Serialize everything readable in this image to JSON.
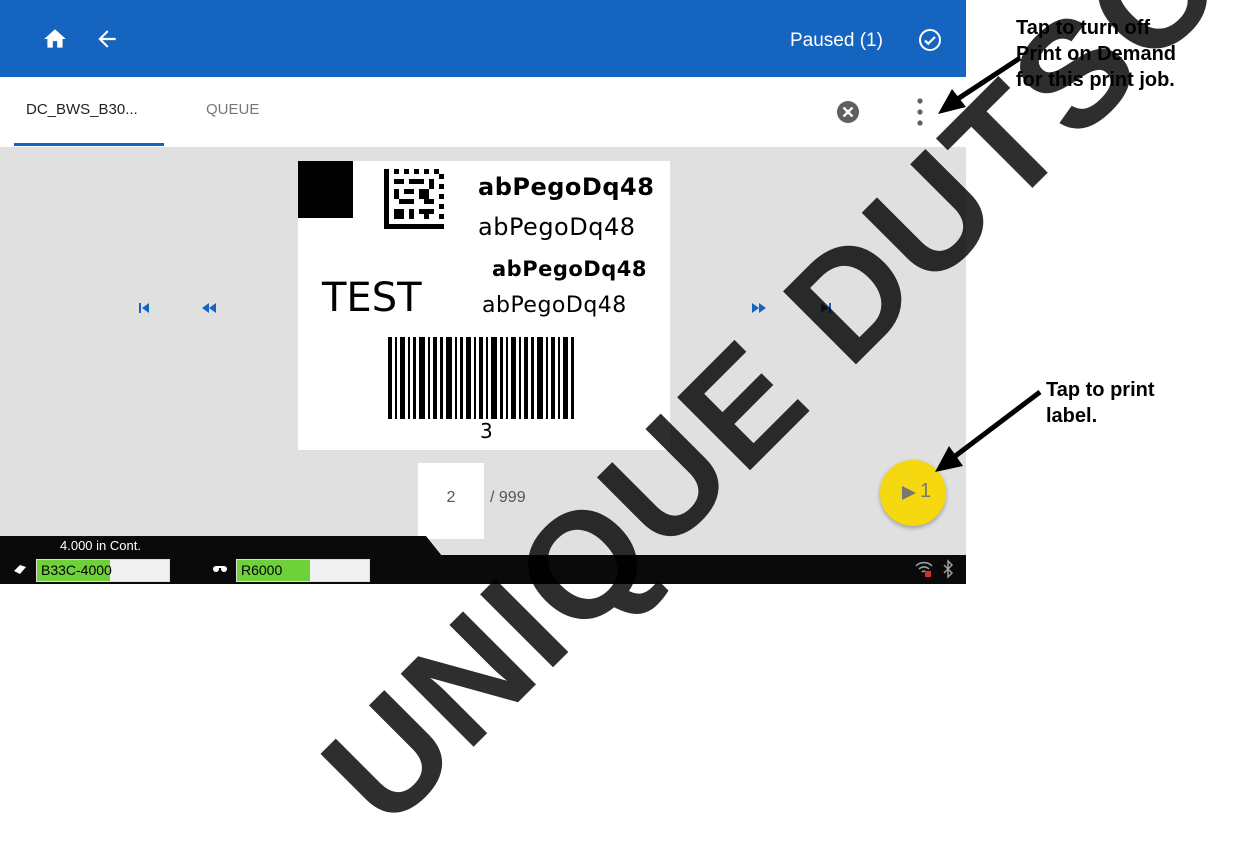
{
  "topbar": {
    "status_text": "Paused (1)",
    "colors": {
      "bar": "#1565c0",
      "text": "#ffffff"
    }
  },
  "tabs": [
    {
      "label": "DC_BWS_B30...",
      "active": true
    },
    {
      "label": "QUEUE",
      "active": false
    }
  ],
  "label_preview": {
    "lines": [
      "abPegoDq48",
      "abPegoDq48",
      "abPegoDq48",
      "abPegoDq48"
    ],
    "test_text": "TEST",
    "barcode_number": "3"
  },
  "pager": {
    "current_page": "2",
    "total": "/ 999"
  },
  "print_button": {
    "count": "1",
    "color": "#f5d80f"
  },
  "status_bar": {
    "media_text": "4.000 in Cont.",
    "supplies": [
      {
        "name": "B33C-4000",
        "level": 0.55
      },
      {
        "name": "R6000",
        "level": 0.55
      }
    ]
  },
  "callouts": {
    "top": [
      "Tap to turn off",
      "Print on Demand",
      "for this print job."
    ],
    "bottom": [
      "Tap to print",
      "label."
    ]
  },
  "watermark": "UNIQUE DUTSCH"
}
